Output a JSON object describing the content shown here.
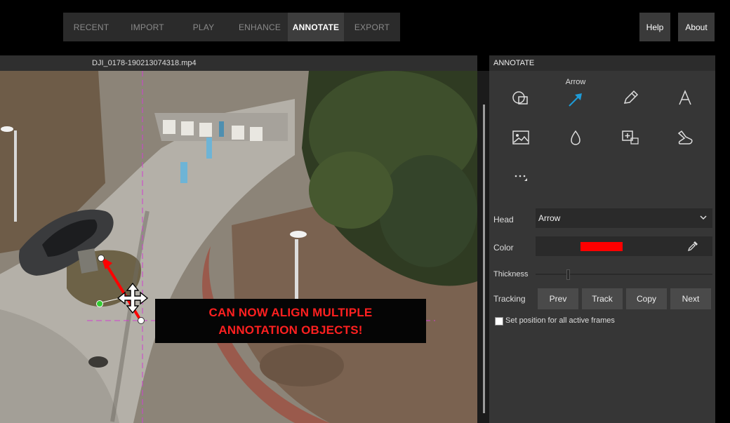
{
  "nav": {
    "tabs": [
      {
        "label": "RECENT"
      },
      {
        "label": "IMPORT"
      },
      {
        "label": "PLAY"
      },
      {
        "label": "ENHANCE"
      },
      {
        "label": "ANNOTATE"
      },
      {
        "label": "EXPORT"
      }
    ],
    "active_tab": "ANNOTATE",
    "help_label": "Help",
    "about_label": "About"
  },
  "video": {
    "filename": "DJI_0178-190213074318.mp4",
    "banner_line1": "CAN NOW ALIGN MULTIPLE",
    "banner_line2": "ANNOTATION OBJECTS!"
  },
  "panel": {
    "title": "ANNOTATE",
    "tools": [
      {
        "icon": "shape-icon"
      },
      {
        "icon": "arrow-icon",
        "label": "Arrow"
      },
      {
        "icon": "pencil-icon"
      },
      {
        "icon": "text-icon"
      },
      {
        "icon": "image-icon"
      },
      {
        "icon": "blur-drop-icon"
      },
      {
        "icon": "magnify-region-icon"
      },
      {
        "icon": "spotlight-icon"
      },
      {
        "icon": "more-icon"
      }
    ],
    "head_label": "Head",
    "head_value": "Arrow",
    "color_label": "Color",
    "color_value": "#ff0000",
    "thickness_label": "Thickness",
    "tracking_label": "Tracking",
    "tracking_buttons": {
      "prev": "Prev",
      "track": "Track",
      "copy": "Copy",
      "next": "Next"
    },
    "set_position_label": "Set position for all active frames"
  },
  "colors": {
    "accent": "#1e9bd7",
    "annotation": "#ff0000",
    "guide": "#d040d0"
  }
}
